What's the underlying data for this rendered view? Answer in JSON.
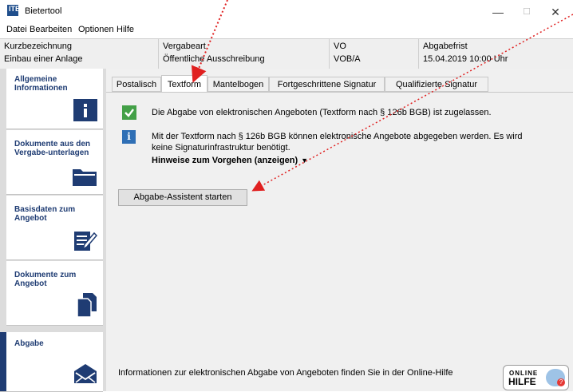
{
  "window": {
    "title": "Bietertool",
    "logo_text": "ITB",
    "minimize": "—",
    "maximize": "☐",
    "close": "✕"
  },
  "menu": [
    "Datei",
    "Bearbeiten",
    "Optionen",
    "Hilfe"
  ],
  "info": {
    "kurz_label": "Kurzbezeichnung",
    "kurz_value": "Einbau einer Anlage",
    "vergabeart_label": "Vergabeart",
    "vergabeart_value": "Öffentliche Ausschreibung",
    "vo_label": "VO",
    "vo_value": "VOB/A",
    "frist_label": "Abgabefrist",
    "frist_value": "15.04.2019 10:00 Uhr"
  },
  "sidebar": {
    "items": [
      {
        "label": "Allgemeine Informationen",
        "icon": "info-icon"
      },
      {
        "label": "Dokumente aus den Vergabe-unterlagen",
        "icon": "folder-icon"
      },
      {
        "label": "Basisdaten zum Angebot",
        "icon": "edit-icon"
      },
      {
        "label": "Dokumente zum Angebot",
        "icon": "documents-icon"
      },
      {
        "label": "Abgabe",
        "icon": "envelope-icon"
      }
    ],
    "active_index": 4
  },
  "tabs": [
    "Postalisch",
    "Textform",
    "Mantelbogen",
    "Fortgeschrittene Signatur",
    "Qualifizierte Signatur"
  ],
  "active_tab": "Textform",
  "content": {
    "message1": "Die Abgabe von elektronischen Angeboten (Textform nach § 126b BGB) ist zugelassen.",
    "message2_line1": "Mit der Textform nach § 126b BGB können elektronische Angebote abgegeben werden. Es wird",
    "message2_line2": "keine Signaturinfrastruktur benötigt.",
    "hint_link": "Hinweise zum Vorgehen (anzeigen)",
    "hint_arrow": "▼",
    "button": "Abgabe-Assistent starten",
    "footer": "Informationen zur elektronischen Abgabe von Angeboten finden Sie in der Online-Hilfe",
    "online_label_top": "ONLINE",
    "online_label_bottom": "HILFE",
    "online_badge": "?"
  },
  "colors": {
    "accent": "#1f3c73",
    "check": "#43a047",
    "info": "#2f6fb5",
    "annotation": "#e02020"
  }
}
